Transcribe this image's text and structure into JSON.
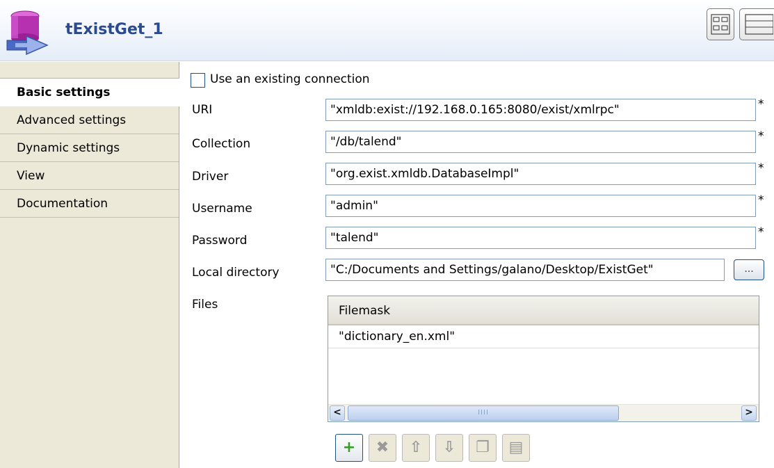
{
  "header": {
    "title": "tExistGet_1",
    "icon": "database-get-icon"
  },
  "sidebar": {
    "tabs": [
      {
        "label": "Basic settings",
        "active": true
      },
      {
        "label": "Advanced settings",
        "active": false
      },
      {
        "label": "Dynamic settings",
        "active": false
      },
      {
        "label": "View",
        "active": false
      },
      {
        "label": "Documentation",
        "active": false
      }
    ]
  },
  "form": {
    "use_existing_connection": {
      "label": "Use an existing connection",
      "checked": false
    },
    "fields": [
      {
        "label": "URI",
        "value": "\"xmldb:exist://192.168.0.165:8080/exist/xmlrpc\"",
        "required": true
      },
      {
        "label": "Collection",
        "value": "\"/db/talend\"",
        "required": true
      },
      {
        "label": "Driver",
        "value": "\"org.exist.xmldb.DatabaseImpl\"",
        "required": true
      },
      {
        "label": "Username",
        "value": "\"admin\"",
        "required": true
      },
      {
        "label": "Password",
        "value": "\"talend\"",
        "required": true
      },
      {
        "label": "Local directory",
        "value": "\"C:/Documents and Settings/galano/Desktop/ExistGet\"",
        "required": false
      }
    ],
    "required_marker": "*",
    "browse_label": "...",
    "files": {
      "label": "Files",
      "columns": [
        "Filemask"
      ],
      "rows": [
        [
          "\"dictionary_en.xml\""
        ]
      ],
      "scroll_thumb_grip": "IIII"
    }
  },
  "toolbar": {
    "buttons": [
      {
        "name": "add",
        "glyph": "+",
        "enabled": true
      },
      {
        "name": "remove",
        "glyph": "✖",
        "enabled": false
      },
      {
        "name": "move-up",
        "glyph": "⇧",
        "enabled": false
      },
      {
        "name": "move-down",
        "glyph": "⇩",
        "enabled": false
      },
      {
        "name": "copy",
        "glyph": "❐",
        "enabled": false
      },
      {
        "name": "paste",
        "glyph": "▤",
        "enabled": false
      }
    ]
  },
  "colors": {
    "title": "#2a4b8f",
    "sidebar_bg": "#ece9d8",
    "input_border": "#7f9db9",
    "add_green": "#3a9a2a"
  }
}
